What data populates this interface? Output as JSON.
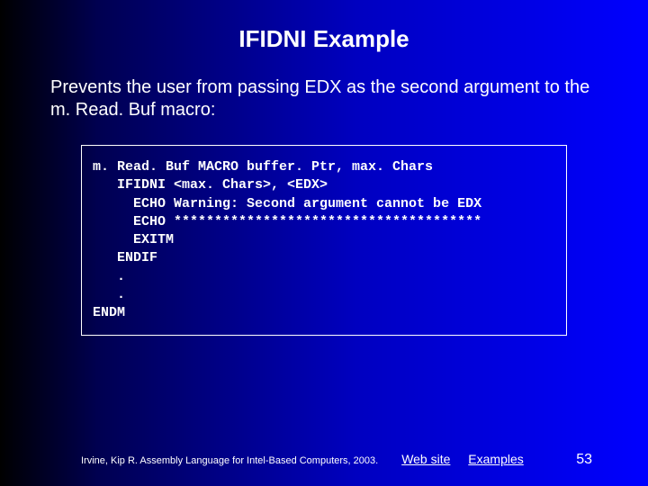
{
  "title": "IFIDNI Example",
  "body": "Prevents the user from passing EDX as the second argument to the m. Read. Buf macro:",
  "code": "m. Read. Buf MACRO buffer. Ptr, max. Chars\n   IFIDNI <max. Chars>, <EDX>\n     ECHO Warning: Second argument cannot be EDX\n     ECHO **************************************\n     EXITM\n   ENDIF\n   .\n   .\nENDM",
  "footer": {
    "credit": "Irvine, Kip R. Assembly Language for Intel-Based Computers, 2003.",
    "link1": "Web site",
    "link2": "Examples",
    "page": "53"
  }
}
